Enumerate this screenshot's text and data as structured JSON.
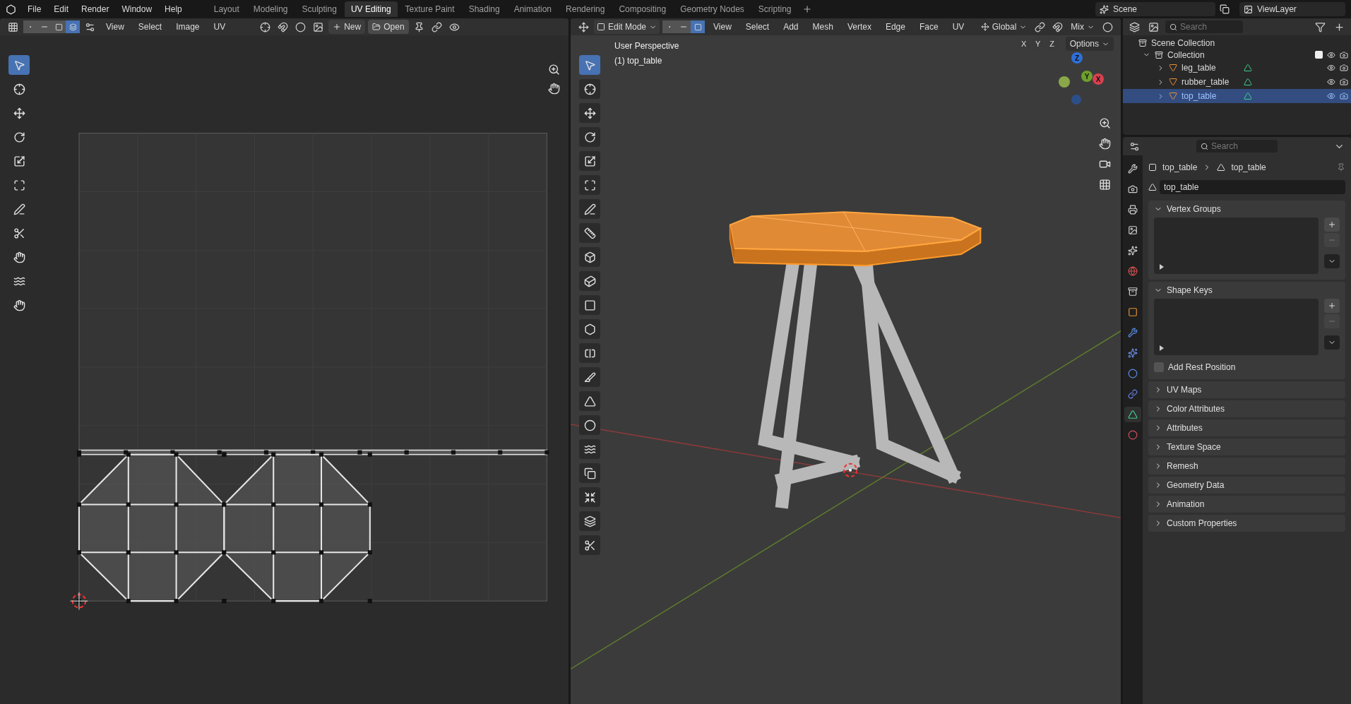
{
  "menu": [
    "File",
    "Edit",
    "Render",
    "Window",
    "Help"
  ],
  "workspaces": [
    {
      "label": "Layout",
      "selected": false
    },
    {
      "label": "Modeling",
      "selected": false
    },
    {
      "label": "Sculpting",
      "selected": false
    },
    {
      "label": "UV Editing",
      "selected": true
    },
    {
      "label": "Texture Paint",
      "selected": false
    },
    {
      "label": "Shading",
      "selected": false
    },
    {
      "label": "Animation",
      "selected": false
    },
    {
      "label": "Rendering",
      "selected": false
    },
    {
      "label": "Compositing",
      "selected": false
    },
    {
      "label": "Geometry Nodes",
      "selected": false
    },
    {
      "label": "Scripting",
      "selected": false
    }
  ],
  "scene": "Scene",
  "view_layer": "ViewLayer",
  "uv_editor": {
    "menus": [
      "View",
      "Select",
      "Image",
      "UV"
    ],
    "new_label": "New",
    "open_label": "Open",
    "select_modes": [
      {
        "kind": "vertex",
        "selected": false
      },
      {
        "kind": "edge",
        "selected": false
      },
      {
        "kind": "face",
        "selected": false
      },
      {
        "kind": "island",
        "selected": true
      }
    ],
    "tools": [
      {
        "kind": "select",
        "selected": true
      },
      {
        "kind": "cursor",
        "selected": false
      },
      {
        "kind": "move",
        "selected": false
      },
      {
        "kind": "rotate",
        "selected": false
      },
      {
        "kind": "scale",
        "selected": false
      },
      {
        "kind": "transform",
        "selected": false
      },
      {
        "kind": "annotate",
        "selected": false
      },
      {
        "kind": "rip",
        "selected": false
      },
      {
        "kind": "grab",
        "selected": false
      },
      {
        "kind": "relax",
        "selected": false
      },
      {
        "kind": "pinch",
        "selected": false
      }
    ]
  },
  "viewport": {
    "mode": "Edit Mode",
    "menus": [
      "View",
      "Select",
      "Add",
      "Mesh",
      "Vertex",
      "Edge",
      "Face",
      "UV"
    ],
    "orientation": "Global",
    "pivot": "Mix",
    "axes": [
      "X",
      "Y",
      "Z"
    ],
    "options": "Options",
    "info": [
      "User Perspective",
      "(1) top_table"
    ],
    "gizmo": [
      "Z",
      "Y",
      "X"
    ],
    "select_modes": [
      {
        "kind": "vertex",
        "selected": false
      },
      {
        "kind": "edge",
        "selected": false
      },
      {
        "kind": "face",
        "selected": true
      }
    ],
    "tools": [
      {
        "kind": "select",
        "selected": true
      },
      {
        "kind": "cursor",
        "selected": false
      },
      {
        "kind": "move",
        "selected": false
      },
      {
        "kind": "rotate",
        "selected": false
      },
      {
        "kind": "scale",
        "selected": false
      },
      {
        "kind": "transform",
        "selected": false
      },
      {
        "kind": "annotate",
        "selected": false
      },
      {
        "kind": "measure",
        "selected": false
      },
      {
        "kind": "add-cube",
        "selected": false
      },
      {
        "kind": "extrude",
        "selected": false
      },
      {
        "kind": "inset",
        "selected": false
      },
      {
        "kind": "bevel",
        "selected": false
      },
      {
        "kind": "loop-cut",
        "selected": false
      },
      {
        "kind": "knife",
        "selected": false
      },
      {
        "kind": "poly-build",
        "selected": false
      },
      {
        "kind": "spin",
        "selected": false
      },
      {
        "kind": "smooth",
        "selected": false
      },
      {
        "kind": "edge-slide",
        "selected": false
      },
      {
        "kind": "shrink",
        "selected": false
      },
      {
        "kind": "shear",
        "selected": false
      },
      {
        "kind": "rip",
        "selected": false
      }
    ]
  },
  "outliner": {
    "search_placeholder": "Search",
    "root": "Scene Collection",
    "collection": {
      "name": "Collection",
      "checked": true,
      "expanded": true,
      "children": [
        {
          "name": "leg_table",
          "selected": false
        },
        {
          "name": "rubber_table",
          "selected": false
        },
        {
          "name": "top_table",
          "selected": true
        }
      ]
    }
  },
  "properties": {
    "search_placeholder": "Search",
    "breadcrumb": [
      "top_table",
      "top_table"
    ],
    "mesh_name": "top_table",
    "tabs": [
      {
        "kind": "tool",
        "selected": false
      },
      {
        "kind": "render",
        "selected": false
      },
      {
        "kind": "output",
        "selected": false
      },
      {
        "kind": "view_layer",
        "selected": false
      },
      {
        "kind": "scene",
        "selected": false
      },
      {
        "kind": "world",
        "selected": false
      },
      {
        "kind": "collection",
        "selected": false
      },
      {
        "kind": "object",
        "selected": false
      },
      {
        "kind": "modifiers",
        "selected": false
      },
      {
        "kind": "particles",
        "selected": false
      },
      {
        "kind": "physics",
        "selected": false
      },
      {
        "kind": "constraints",
        "selected": false
      },
      {
        "kind": "data",
        "selected": true
      },
      {
        "kind": "material",
        "selected": false
      }
    ],
    "panels": [
      {
        "title": "Vertex Groups",
        "expanded": true
      },
      {
        "title": "Shape Keys",
        "expanded": true,
        "checkbox": {
          "label": "Add Rest Position",
          "checked": false
        }
      },
      {
        "title": "UV Maps",
        "expanded": false
      },
      {
        "title": "Color Attributes",
        "expanded": false
      },
      {
        "title": "Attributes",
        "expanded": false
      },
      {
        "title": "Texture Space",
        "expanded": false
      },
      {
        "title": "Remesh",
        "expanded": false
      },
      {
        "title": "Geometry Data",
        "expanded": false
      },
      {
        "title": "Animation",
        "expanded": false
      },
      {
        "title": "Custom Properties",
        "expanded": false
      }
    ]
  }
}
